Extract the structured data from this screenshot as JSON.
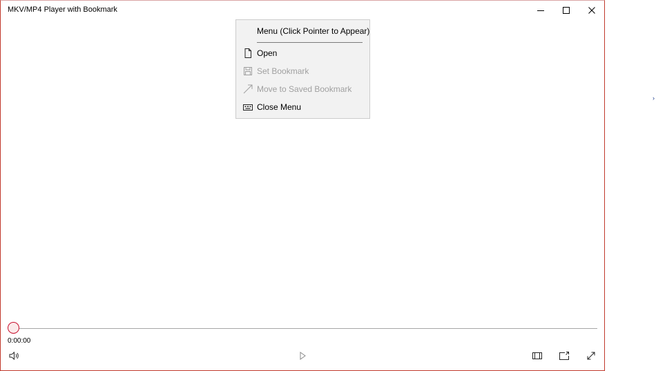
{
  "window": {
    "title": "MKV/MP4 Player with Bookmark",
    "controls": [
      "minimize-icon",
      "maximize-icon",
      "close-icon"
    ]
  },
  "menu": {
    "header": "Menu (Click Pointer to Appear)",
    "items": [
      {
        "label": "Open",
        "icon": "file-icon",
        "enabled": true
      },
      {
        "label": "Set Bookmark",
        "icon": "save-icon",
        "enabled": false
      },
      {
        "label": "Move to Saved Bookmark",
        "icon": "arrow-diagonal-icon",
        "enabled": false
      },
      {
        "label": "Close Menu",
        "icon": "keyboard-close-icon",
        "enabled": true
      }
    ]
  },
  "player": {
    "time": "0:00:00",
    "progress": 0,
    "colors": {
      "seek_thumb": "#c8102e",
      "track": "#a6a6a6"
    },
    "controls": {
      "left": [
        "volume-icon"
      ],
      "center": [
        "play-icon"
      ],
      "right": [
        "compact-overlay-icon",
        "cast-icon",
        "fullscreen-icon"
      ]
    }
  }
}
